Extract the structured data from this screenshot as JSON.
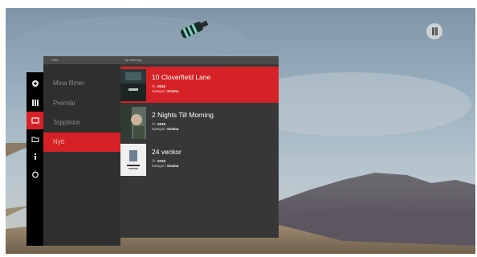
{
  "header": {
    "categories_label": "Hitta",
    "list_label": "Ny utökning"
  },
  "rail": [
    {
      "icon": "gear-icon",
      "active": false
    },
    {
      "icon": "grid-icon",
      "active": false
    },
    {
      "icon": "tv-icon",
      "active": true
    },
    {
      "icon": "folder-icon",
      "active": false
    },
    {
      "icon": "info-icon",
      "active": false
    },
    {
      "icon": "power-icon",
      "active": false
    }
  ],
  "categories": {
    "items": [
      {
        "label": "Mina filmer",
        "active": false
      },
      {
        "label": "Premiär",
        "active": false
      },
      {
        "label": "Topplistor",
        "active": false
      },
      {
        "label": "Nytt",
        "active": true
      }
    ]
  },
  "titles": {
    "items": [
      {
        "title": "10 Cloverfield Lane",
        "year_label": "År:",
        "year": "2016",
        "category_label": "Kategori:",
        "category": "Drama",
        "active": true
      },
      {
        "title": "2 Nights Till Morning",
        "year_label": "År:",
        "year": "2015",
        "category_label": "Kategori:",
        "category": "Drama",
        "active": false
      },
      {
        "title": "24 veckor",
        "year_label": "År:",
        "year": "2016",
        "category_label": "Kategori:",
        "category": "Drama",
        "active": false
      }
    ]
  },
  "colors": {
    "accent": "#d62226",
    "panel": "#373737",
    "rail": "#000000"
  }
}
